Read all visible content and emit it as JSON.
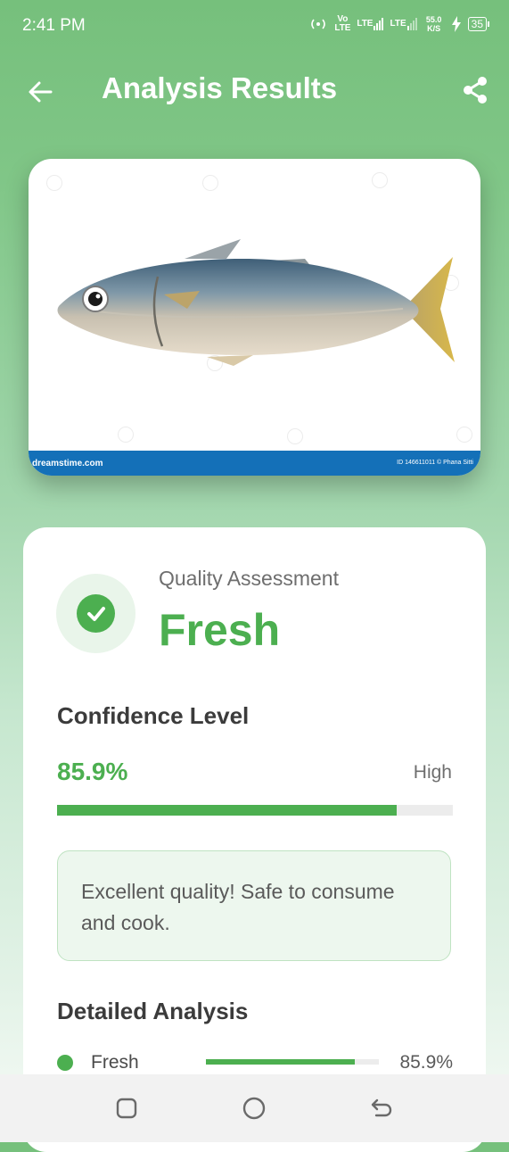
{
  "status_bar": {
    "time": "2:41 PM",
    "volte": "Vo LTE",
    "lte1": "LTE",
    "lte2": "LTE",
    "speed": "55.0 K/S",
    "battery": "35"
  },
  "app_bar": {
    "title": "Analysis Results",
    "back_icon": "arrow-left-icon",
    "share_icon": "share-icon"
  },
  "image": {
    "subject": "fish",
    "watermark_left": "dreamstime.com",
    "watermark_right": "ID 146611011 © Phana Sitti"
  },
  "quality": {
    "label": "Quality Assessment",
    "value": "Fresh",
    "icon": "check-circle-icon"
  },
  "confidence": {
    "title": "Confidence Level",
    "value": "85.9%",
    "level": "High",
    "fraction": 0.859
  },
  "message": "Excellent quality! Safe to consume and cook.",
  "detailed": {
    "title": "Detailed Analysis",
    "items": [
      {
        "label": "Fresh",
        "value": "85.9%",
        "fraction": 0.859
      }
    ]
  },
  "colors": {
    "accent": "#4caf50",
    "header": "#7bc380",
    "message_bg": "#edf7ee",
    "watermark_bar": "#1470b8"
  },
  "nav_bar": {
    "icons": [
      "recent-apps-icon",
      "home-icon",
      "back-icon"
    ]
  }
}
